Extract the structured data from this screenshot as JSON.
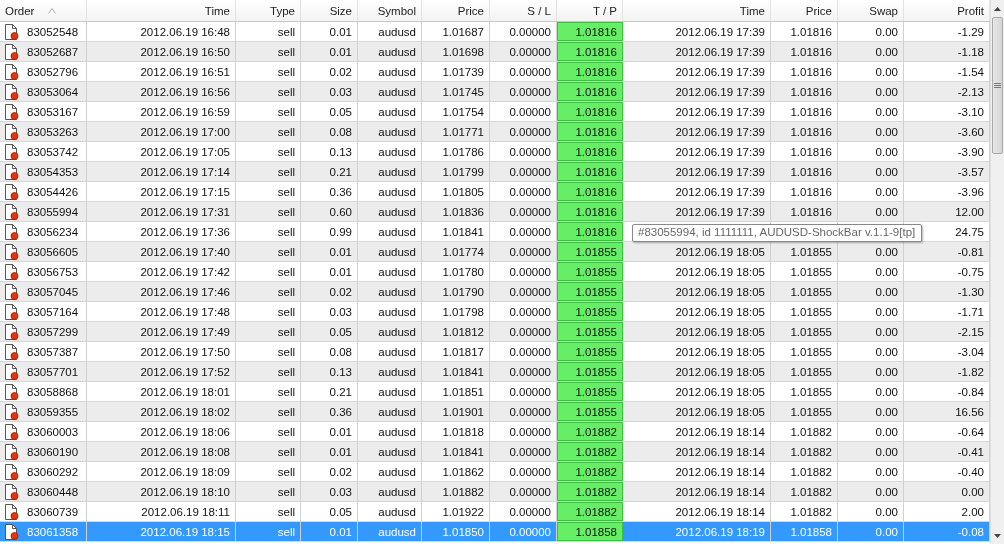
{
  "columns": [
    {
      "label": "Order",
      "sorted": true
    },
    {
      "label": "Time",
      "sorted": false
    },
    {
      "label": "Type",
      "sorted": false
    },
    {
      "label": "Size",
      "sorted": false
    },
    {
      "label": "Symbol",
      "sorted": false
    },
    {
      "label": "Price",
      "sorted": false
    },
    {
      "label": "S / L",
      "sorted": false
    },
    {
      "label": "T / P",
      "sorted": false
    },
    {
      "label": "Time",
      "sorted": false
    },
    {
      "label": "Price",
      "sorted": false
    },
    {
      "label": "Swap",
      "sorted": false
    },
    {
      "label": "Profit",
      "sorted": false
    }
  ],
  "rows": [
    {
      "selected": false,
      "order": "83052548",
      "time": "2012.06.19 16:48",
      "type": "sell",
      "size": "0.01",
      "symbol": "audusd",
      "price": "1.01687",
      "sl": "0.00000",
      "tp": "1.01816",
      "close_time": "2012.06.19 17:39",
      "close_price": "1.01816",
      "swap": "0.00",
      "profit": "-1.29"
    },
    {
      "selected": false,
      "order": "83052687",
      "time": "2012.06.19 16:50",
      "type": "sell",
      "size": "0.01",
      "symbol": "audusd",
      "price": "1.01698",
      "sl": "0.00000",
      "tp": "1.01816",
      "close_time": "2012.06.19 17:39",
      "close_price": "1.01816",
      "swap": "0.00",
      "profit": "-1.18"
    },
    {
      "selected": false,
      "order": "83052796",
      "time": "2012.06.19 16:51",
      "type": "sell",
      "size": "0.02",
      "symbol": "audusd",
      "price": "1.01739",
      "sl": "0.00000",
      "tp": "1.01816",
      "close_time": "2012.06.19 17:39",
      "close_price": "1.01816",
      "swap": "0.00",
      "profit": "-1.54"
    },
    {
      "selected": false,
      "order": "83053064",
      "time": "2012.06.19 16:56",
      "type": "sell",
      "size": "0.03",
      "symbol": "audusd",
      "price": "1.01745",
      "sl": "0.00000",
      "tp": "1.01816",
      "close_time": "2012.06.19 17:39",
      "close_price": "1.01816",
      "swap": "0.00",
      "profit": "-2.13"
    },
    {
      "selected": false,
      "order": "83053167",
      "time": "2012.06.19 16:59",
      "type": "sell",
      "size": "0.05",
      "symbol": "audusd",
      "price": "1.01754",
      "sl": "0.00000",
      "tp": "1.01816",
      "close_time": "2012.06.19 17:39",
      "close_price": "1.01816",
      "swap": "0.00",
      "profit": "-3.10"
    },
    {
      "selected": false,
      "order": "83053263",
      "time": "2012.06.19 17:00",
      "type": "sell",
      "size": "0.08",
      "symbol": "audusd",
      "price": "1.01771",
      "sl": "0.00000",
      "tp": "1.01816",
      "close_time": "2012.06.19 17:39",
      "close_price": "1.01816",
      "swap": "0.00",
      "profit": "-3.60"
    },
    {
      "selected": false,
      "order": "83053742",
      "time": "2012.06.19 17:05",
      "type": "sell",
      "size": "0.13",
      "symbol": "audusd",
      "price": "1.01786",
      "sl": "0.00000",
      "tp": "1.01816",
      "close_time": "2012.06.19 17:39",
      "close_price": "1.01816",
      "swap": "0.00",
      "profit": "-3.90"
    },
    {
      "selected": false,
      "order": "83054353",
      "time": "2012.06.19 17:14",
      "type": "sell",
      "size": "0.21",
      "symbol": "audusd",
      "price": "1.01799",
      "sl": "0.00000",
      "tp": "1.01816",
      "close_time": "2012.06.19 17:39",
      "close_price": "1.01816",
      "swap": "0.00",
      "profit": "-3.57"
    },
    {
      "selected": false,
      "order": "83054426",
      "time": "2012.06.19 17:15",
      "type": "sell",
      "size": "0.36",
      "symbol": "audusd",
      "price": "1.01805",
      "sl": "0.00000",
      "tp": "1.01816",
      "close_time": "2012.06.19 17:39",
      "close_price": "1.01816",
      "swap": "0.00",
      "profit": "-3.96"
    },
    {
      "selected": false,
      "order": "83055994",
      "time": "2012.06.19 17:31",
      "type": "sell",
      "size": "0.60",
      "symbol": "audusd",
      "price": "1.01836",
      "sl": "0.00000",
      "tp": "1.01816",
      "close_time": "2012.06.19 17:39",
      "close_price": "1.01816",
      "swap": "0.00",
      "profit": "12.00"
    },
    {
      "selected": false,
      "order": "83056234",
      "time": "2012.06.19 17:36",
      "type": "sell",
      "size": "0.99",
      "symbol": "audusd",
      "price": "1.01841",
      "sl": "0.00000",
      "tp": "1.01816",
      "profit": "24.75"
    },
    {
      "selected": false,
      "order": "83056605",
      "time": "2012.06.19 17:40",
      "type": "sell",
      "size": "0.01",
      "symbol": "audusd",
      "price": "1.01774",
      "sl": "0.00000",
      "tp": "1.01855",
      "close_time": "2012.06.19 18:05",
      "close_price": "1.01855",
      "swap": "0.00",
      "profit": "-0.81"
    },
    {
      "selected": false,
      "order": "83056753",
      "time": "2012.06.19 17:42",
      "type": "sell",
      "size": "0.01",
      "symbol": "audusd",
      "price": "1.01780",
      "sl": "0.00000",
      "tp": "1.01855",
      "close_time": "2012.06.19 18:05",
      "close_price": "1.01855",
      "swap": "0.00",
      "profit": "-0.75"
    },
    {
      "selected": false,
      "order": "83057045",
      "time": "2012.06.19 17:46",
      "type": "sell",
      "size": "0.02",
      "symbol": "audusd",
      "price": "1.01790",
      "sl": "0.00000",
      "tp": "1.01855",
      "close_time": "2012.06.19 18:05",
      "close_price": "1.01855",
      "swap": "0.00",
      "profit": "-1.30"
    },
    {
      "selected": false,
      "order": "83057164",
      "time": "2012.06.19 17:48",
      "type": "sell",
      "size": "0.03",
      "symbol": "audusd",
      "price": "1.01798",
      "sl": "0.00000",
      "tp": "1.01855",
      "close_time": "2012.06.19 18:05",
      "close_price": "1.01855",
      "swap": "0.00",
      "profit": "-1.71"
    },
    {
      "selected": false,
      "order": "83057299",
      "time": "2012.06.19 17:49",
      "type": "sell",
      "size": "0.05",
      "symbol": "audusd",
      "price": "1.01812",
      "sl": "0.00000",
      "tp": "1.01855",
      "close_time": "2012.06.19 18:05",
      "close_price": "1.01855",
      "swap": "0.00",
      "profit": "-2.15"
    },
    {
      "selected": false,
      "order": "83057387",
      "time": "2012.06.19 17:50",
      "type": "sell",
      "size": "0.08",
      "symbol": "audusd",
      "price": "1.01817",
      "sl": "0.00000",
      "tp": "1.01855",
      "close_time": "2012.06.19 18:05",
      "close_price": "1.01855",
      "swap": "0.00",
      "profit": "-3.04"
    },
    {
      "selected": false,
      "order": "83057701",
      "time": "2012.06.19 17:52",
      "type": "sell",
      "size": "0.13",
      "symbol": "audusd",
      "price": "1.01841",
      "sl": "0.00000",
      "tp": "1.01855",
      "close_time": "2012.06.19 18:05",
      "close_price": "1.01855",
      "swap": "0.00",
      "profit": "-1.82"
    },
    {
      "selected": false,
      "order": "83058868",
      "time": "2012.06.19 18:01",
      "type": "sell",
      "size": "0.21",
      "symbol": "audusd",
      "price": "1.01851",
      "sl": "0.00000",
      "tp": "1.01855",
      "close_time": "2012.06.19 18:05",
      "close_price": "1.01855",
      "swap": "0.00",
      "profit": "-0.84"
    },
    {
      "selected": false,
      "order": "83059355",
      "time": "2012.06.19 18:02",
      "type": "sell",
      "size": "0.36",
      "symbol": "audusd",
      "price": "1.01901",
      "sl": "0.00000",
      "tp": "1.01855",
      "close_time": "2012.06.19 18:05",
      "close_price": "1.01855",
      "swap": "0.00",
      "profit": "16.56"
    },
    {
      "selected": false,
      "order": "83060003",
      "time": "2012.06.19 18:06",
      "type": "sell",
      "size": "0.01",
      "symbol": "audusd",
      "price": "1.01818",
      "sl": "0.00000",
      "tp": "1.01882",
      "close_time": "2012.06.19 18:14",
      "close_price": "1.01882",
      "swap": "0.00",
      "profit": "-0.64"
    },
    {
      "selected": false,
      "order": "83060190",
      "time": "2012.06.19 18:08",
      "type": "sell",
      "size": "0.01",
      "symbol": "audusd",
      "price": "1.01841",
      "sl": "0.00000",
      "tp": "1.01882",
      "close_time": "2012.06.19 18:14",
      "close_price": "1.01882",
      "swap": "0.00",
      "profit": "-0.41"
    },
    {
      "selected": false,
      "order": "83060292",
      "time": "2012.06.19 18:09",
      "type": "sell",
      "size": "0.02",
      "symbol": "audusd",
      "price": "1.01862",
      "sl": "0.00000",
      "tp": "1.01882",
      "close_time": "2012.06.19 18:14",
      "close_price": "1.01882",
      "swap": "0.00",
      "profit": "-0.40"
    },
    {
      "selected": false,
      "order": "83060448",
      "time": "2012.06.19 18:10",
      "type": "sell",
      "size": "0.03",
      "symbol": "audusd",
      "price": "1.01882",
      "sl": "0.00000",
      "tp": "1.01882",
      "close_time": "2012.06.19 18:14",
      "close_price": "1.01882",
      "swap": "0.00",
      "profit": "0.00"
    },
    {
      "selected": false,
      "order": "83060739",
      "time": "2012.06.19 18:11",
      "type": "sell",
      "size": "0.05",
      "symbol": "audusd",
      "price": "1.01922",
      "sl": "0.00000",
      "tp": "1.01882",
      "close_time": "2012.06.19 18:14",
      "close_price": "1.01882",
      "swap": "0.00",
      "profit": "2.00"
    },
    {
      "selected": true,
      "order": "83061358",
      "time": "2012.06.19 18:15",
      "type": "sell",
      "size": "0.01",
      "symbol": "audusd",
      "price": "1.01850",
      "sl": "0.00000",
      "tp": "1.01858",
      "close_time": "2012.06.19 18:19",
      "close_price": "1.01858",
      "swap": "0.00",
      "profit": "-0.08"
    }
  ],
  "tooltip": {
    "text": "#83055994, id 1111111, AUDUSD-ShockBar v.1.1-9[tp]"
  }
}
